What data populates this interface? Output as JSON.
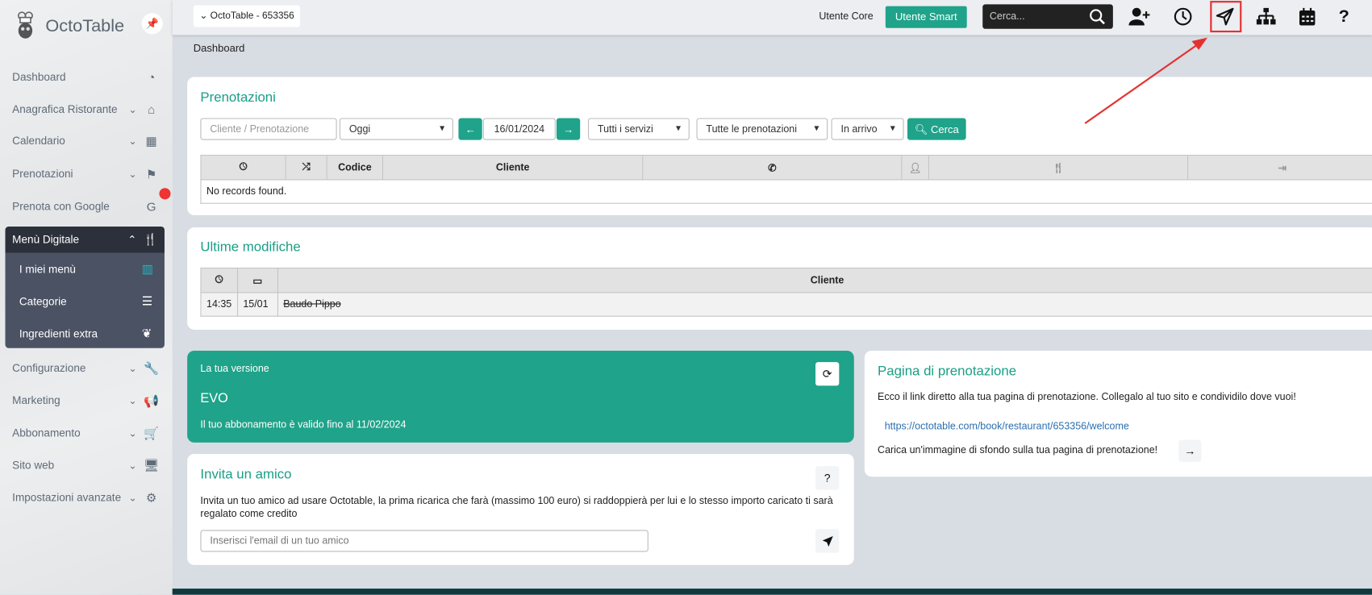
{
  "sidebar": {
    "brand": "OctoTable",
    "items": [
      {
        "label": "Dashboard",
        "icon": "dashboard-gauge-icon",
        "glyph": "◔",
        "chevron": ""
      },
      {
        "label": "Anagrafica Ristorante",
        "icon": "home-icon",
        "glyph": "⌂",
        "chevron": "⌄"
      },
      {
        "label": "Calendario",
        "icon": "calendar-icon",
        "glyph": "▦",
        "chevron": "⌄"
      },
      {
        "label": "Prenotazioni",
        "icon": "flag-checkered-icon",
        "glyph": "⚑",
        "chevron": "⌄"
      },
      {
        "label": "Prenota con Google",
        "icon": "google-icon",
        "glyph": "G",
        "chevron": ""
      },
      {
        "label": "Configurazione",
        "icon": "wrench-icon",
        "glyph": "🔧",
        "chevron": "⌄"
      },
      {
        "label": "Marketing",
        "icon": "megaphone-icon",
        "glyph": "📢",
        "chevron": "⌄"
      },
      {
        "label": "Abbonamento",
        "icon": "cart-icon",
        "glyph": "🛒",
        "chevron": "⌄"
      },
      {
        "label": "Sito web",
        "icon": "desktop-icon",
        "glyph": "🖥",
        "chevron": "⌄"
      },
      {
        "label": "Impostazioni avanzate",
        "icon": "cogs-icon",
        "glyph": "⚙",
        "chevron": "⌄"
      }
    ],
    "active_group": {
      "label": "Menù Digitale",
      "chevron": "⌃",
      "icon": "utensils-icon",
      "glyph": "🍴",
      "children": [
        {
          "label": "I miei menù",
          "icon": "map-icon",
          "glyph": "▥",
          "color": "#2bb3c0"
        },
        {
          "label": "Categorie",
          "icon": "list-icon",
          "glyph": "☰",
          "color": "#ffffff"
        },
        {
          "label": "Ingredienti extra",
          "icon": "leaf-icon",
          "glyph": "❦",
          "color": "#ffffff"
        }
      ]
    }
  },
  "topbar": {
    "account": "OctoTable - 653356",
    "user_core": "Utente Core",
    "user_smart": "Utente Smart",
    "search_placeholder": "Cerca...",
    "icons": [
      "add-user-icon",
      "clock-icon",
      "paper-plane-icon",
      "sitemap-icon",
      "calendar-icon",
      "help-icon"
    ],
    "highlighted_icon": "paper-plane-icon"
  },
  "breadcrumb": "Dashboard",
  "prenotazioni": {
    "title": "Prenotazioni",
    "search_placeholder": "Cliente / Prenotazione",
    "period": "Oggi",
    "date": "16/01/2024",
    "services": "Tutti i servizi",
    "bookings": "Tutte le prenotazioni",
    "status": "In arrivo",
    "search_button": "Cerca",
    "columns": [
      "clock-icon",
      "shuffle-icon",
      "Codice",
      "Cliente",
      "phone-icon",
      "user-icon",
      "utensils-icon",
      "sign-in-icon"
    ],
    "empty": "No records found."
  },
  "ultime": {
    "title": "Ultime modifiche",
    "columns": [
      "clock-icon",
      "calendar-icon",
      "Cliente"
    ],
    "rows": [
      {
        "time": "14:35",
        "date": "15/01",
        "cliente": "Baudo Pippo"
      }
    ]
  },
  "versione": {
    "label": "La tua versione",
    "name": "EVO",
    "validity": "Il tuo abbonamento è valido fino al 11/02/2024"
  },
  "invita": {
    "title": "Invita un amico",
    "help": "?",
    "text": "Invita un tuo amico ad usare Octotable, la prima ricarica che farà (massimo 100 euro) si raddoppierà per lui e lo stesso importo caricato ti sarà regalato come credito",
    "email_placeholder": "Inserisci l'email di un tuo amico"
  },
  "pagina": {
    "title": "Pagina di prenotazione",
    "text": "Ecco il link diretto alla tua pagina di prenotazione. Collegalo al tuo sito e condividilo dove vuoi!",
    "link": "https://octotable.com/book/restaurant/653356/welcome",
    "upload_text": "Carica un'immagine di sfondo sulla tua pagina di prenotazione!"
  },
  "colors": {
    "accent": "#1fa38a",
    "sidebar_active": "#2b303a",
    "annotation": "#e53030",
    "link": "#2a6fb0"
  }
}
